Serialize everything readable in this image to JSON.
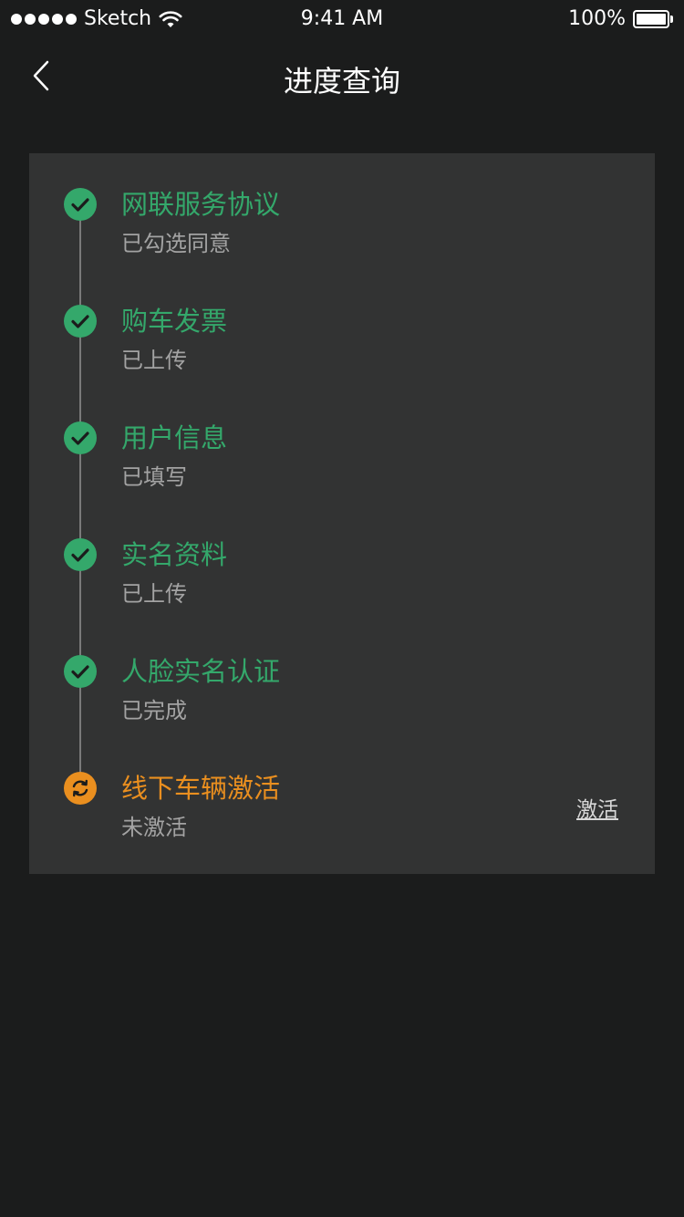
{
  "status_bar": {
    "carrier": "Sketch",
    "time": "9:41 AM",
    "battery": "100%",
    "icons": [
      "signal-dots-icon",
      "wifi-icon",
      "battery-icon"
    ]
  },
  "nav": {
    "title": "进度查询",
    "back_icon": "chevron-left-icon"
  },
  "colors": {
    "background": "#1b1c1c",
    "card": "#323333",
    "done": "#34a86b",
    "pending": "#ea8f1f",
    "secondary_text": "#a3a3a3"
  },
  "steps": [
    {
      "title": "网联服务协议",
      "status": "已勾选同意",
      "state": "done",
      "icon": "check-circle-icon"
    },
    {
      "title": "购车发票",
      "status": "已上传",
      "state": "done",
      "icon": "check-circle-icon"
    },
    {
      "title": "用户信息",
      "status": "已填写",
      "state": "done",
      "icon": "check-circle-icon"
    },
    {
      "title": "实名资料",
      "status": "已上传",
      "state": "done",
      "icon": "check-circle-icon"
    },
    {
      "title": "人脸实名认证",
      "status": "已完成",
      "state": "done",
      "icon": "check-circle-icon"
    },
    {
      "title": "线下车辆激活",
      "status": "未激活",
      "state": "pending",
      "icon": "refresh-circle-icon",
      "action": "激活"
    }
  ]
}
